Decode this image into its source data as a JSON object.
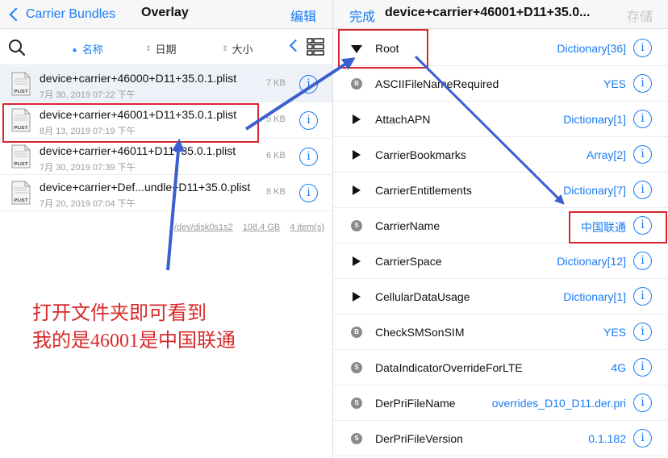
{
  "left_nav": {
    "back_label": "Carrier Bundles",
    "title": "Overlay",
    "edit_label": "编辑"
  },
  "sort_bar": {
    "name_label": "名称",
    "date_label": "日期",
    "size_label": "大小"
  },
  "files": [
    {
      "name": "device+carrier+46000+D11+35.0.1.plist",
      "date": "7月 30, 2019 07:22 下午",
      "size": "7 KB",
      "icon_text": "PLIST"
    },
    {
      "name": "device+carrier+46001+D11+35.0.1.plist",
      "date": "8月 13, 2019 07:19 下午",
      "size": "5 KB",
      "icon_text": "PLIST"
    },
    {
      "name": "device+carrier+46011+D11+35.0.1.plist",
      "date": "7月 30, 2019 07:39 下午",
      "size": "6 KB",
      "icon_text": "PLIST"
    },
    {
      "name": "device+carrier+Def...undle+D11+35.0.plist",
      "date": "7月 20, 2019 07:04 下午",
      "size": "8 KB",
      "icon_text": "PLIST"
    }
  ],
  "footer": {
    "disk": "/dev/disk0s1s2",
    "free": "108.4 GB",
    "count": "4 item(s)"
  },
  "annotation": {
    "line1": "打开文件夹即可看到",
    "line2": "我的是46001是中国联通"
  },
  "right_nav": {
    "done_label": "完成",
    "title": "device+carrier+46001+D11+35.0...",
    "save_label": "存储"
  },
  "plist_rows": [
    {
      "key": "Root",
      "value": "Dictionary[36]",
      "kind": "expanded"
    },
    {
      "key": "ASCIIFileNameRequired",
      "value": "YES",
      "kind": "badge",
      "badge": "B"
    },
    {
      "key": "AttachAPN",
      "value": "Dictionary[1]",
      "kind": "collapsed"
    },
    {
      "key": "CarrierBookmarks",
      "value": "Array[2]",
      "kind": "collapsed"
    },
    {
      "key": "CarrierEntitlements",
      "value": "Dictionary[7]",
      "kind": "collapsed"
    },
    {
      "key": "CarrierName",
      "value": "中国联通",
      "kind": "badge",
      "badge": "S"
    },
    {
      "key": "CarrierSpace",
      "value": "Dictionary[12]",
      "kind": "collapsed"
    },
    {
      "key": "CellularDataUsage",
      "value": "Dictionary[1]",
      "kind": "collapsed"
    },
    {
      "key": "CheckSMSonSIM",
      "value": "YES",
      "kind": "badge",
      "badge": "B"
    },
    {
      "key": "DataIndicatorOverrideForLTE",
      "value": "4G",
      "kind": "badge",
      "badge": "S"
    },
    {
      "key": "DerPriFileName",
      "value": "overrides_D10_D11.der.pri",
      "kind": "badge",
      "badge": "S"
    },
    {
      "key": "DerPriFileVersion",
      "value": "0.1.182",
      "kind": "badge",
      "badge": "S"
    }
  ],
  "info_glyph": "i",
  "colors": {
    "accent": "#1a7cf5",
    "annotation_red": "#d72a2a",
    "arrow_blue": "#3a5fcf"
  }
}
